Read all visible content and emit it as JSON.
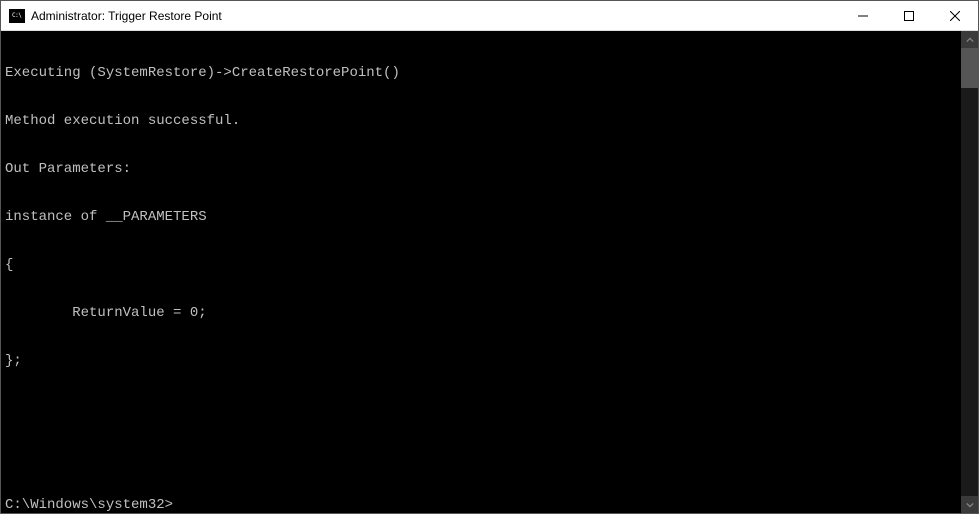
{
  "window": {
    "title": "Administrator: Trigger Restore Point",
    "icon_label": "cmd-icon"
  },
  "controls": {
    "minimize_label": "Minimize",
    "maximize_label": "Maximize",
    "close_label": "Close"
  },
  "console": {
    "lines": [
      "Executing (SystemRestore)->CreateRestorePoint()",
      "Method execution successful.",
      "Out Parameters:",
      "instance of __PARAMETERS",
      "{",
      "        ReturnValue = 0;",
      "};",
      "",
      "",
      "C:\\Windows\\system32>"
    ],
    "prompt": "C:\\Windows\\system32>",
    "prompt_index": 9
  }
}
